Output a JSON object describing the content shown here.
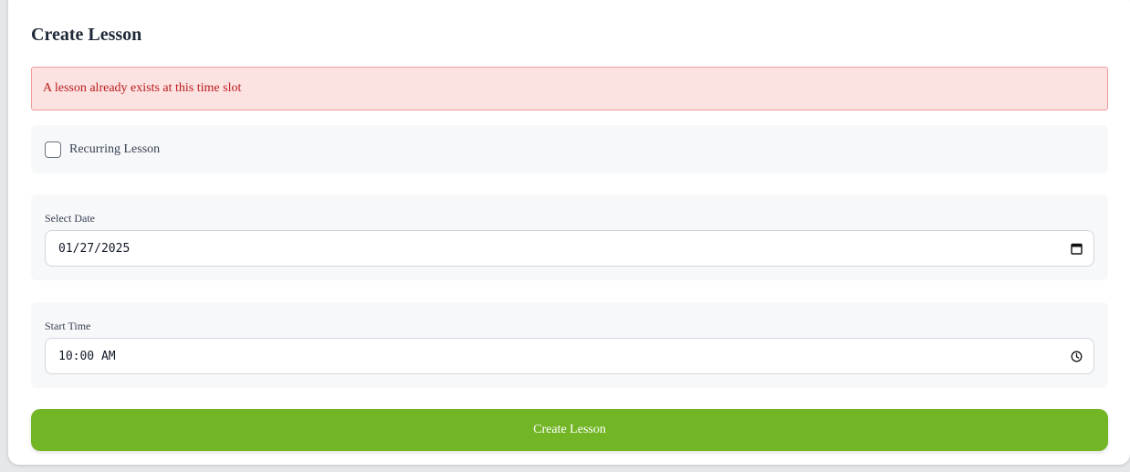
{
  "page": {
    "title": "Create Lesson"
  },
  "alert": {
    "message": "A lesson already exists at this time slot"
  },
  "recurring": {
    "label": "Recurring Lesson",
    "checked": false
  },
  "date_field": {
    "label": "Select Date",
    "value": "01/27/2025",
    "icon": "calendar-icon"
  },
  "time_field": {
    "label": "Start Time",
    "value": "10:00 AM",
    "icon": "clock-icon"
  },
  "submit": {
    "label": "Create Lesson"
  },
  "colors": {
    "accent": "#72b626",
    "alert_bg": "#fde2e2",
    "alert_border": "#f19a9a",
    "alert_text": "#b91c1c"
  }
}
